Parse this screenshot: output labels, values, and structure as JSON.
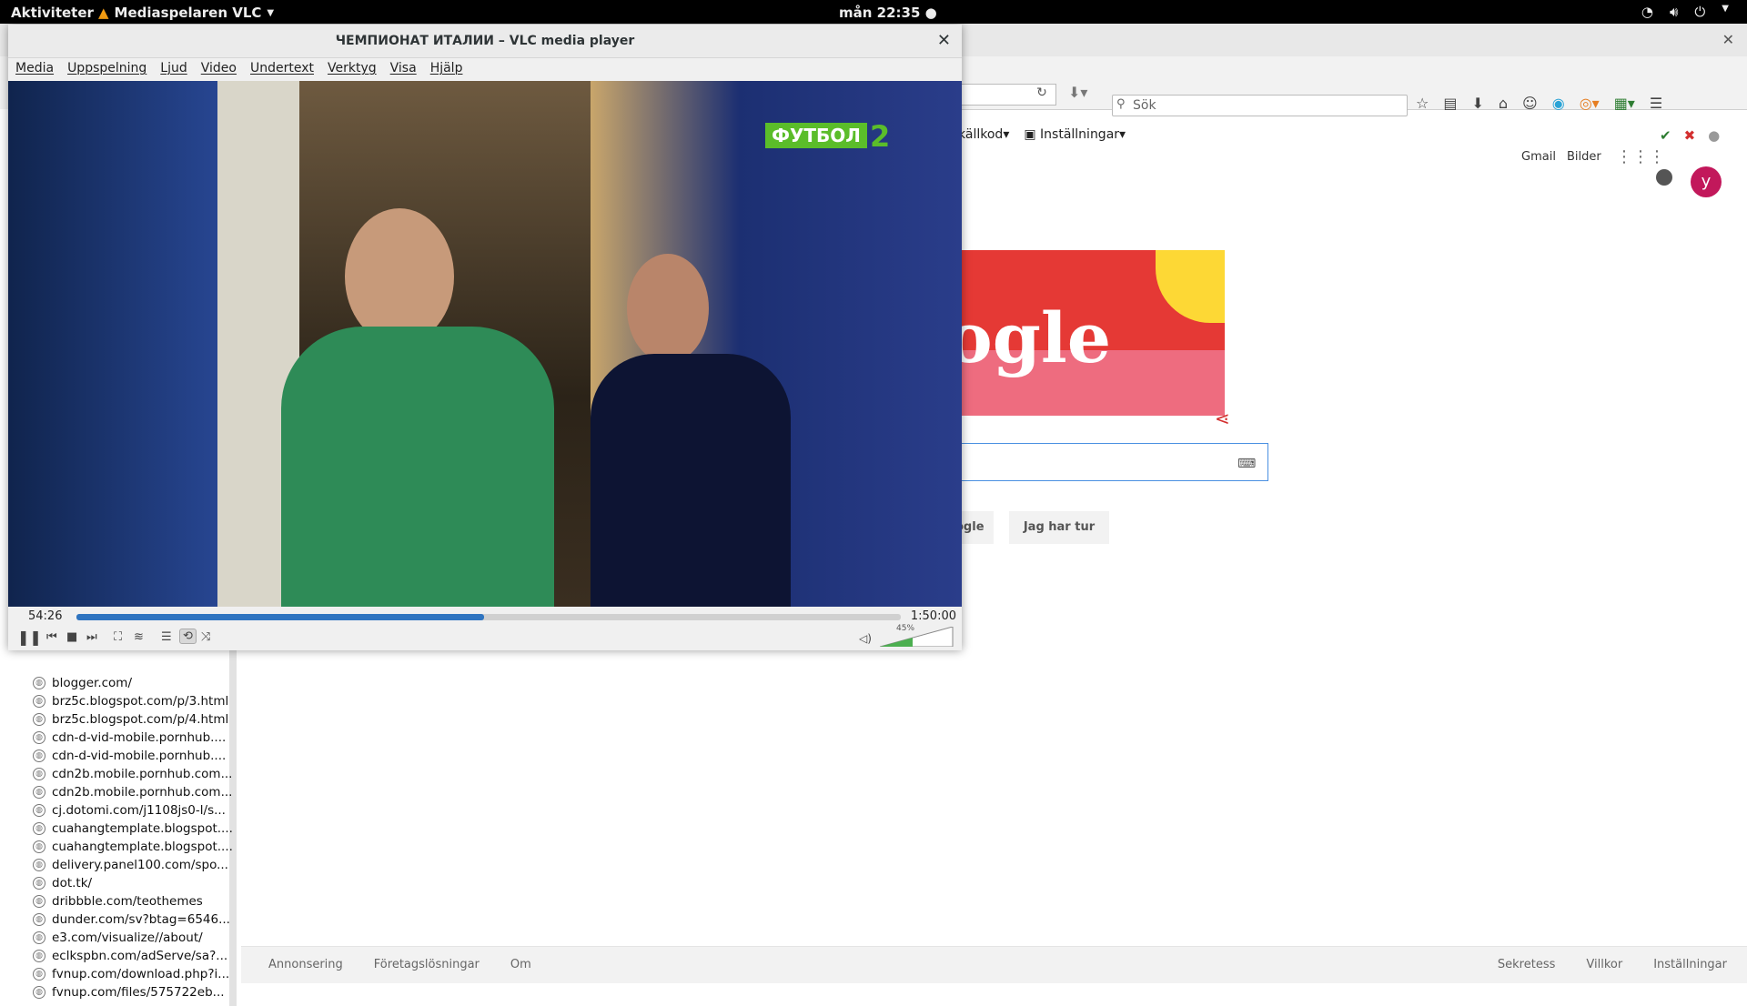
{
  "topbar": {
    "activities": "Aktiviteter",
    "app_name": "Mediaspelaren VLC",
    "clock": "mån 22:35"
  },
  "browser": {
    "search_placeholder": "Sök",
    "bookmarks": [
      "a källkod",
      "Inställningar"
    ],
    "history_items": [
      "blogger.com/",
      "brz5c.blogspot.com/p/3.html",
      "brz5c.blogspot.com/p/4.html",
      "cdn-d-vid-mobile.pornhub....",
      "cdn-d-vid-mobile.pornhub....",
      "cdn2b.mobile.pornhub.com...",
      "cdn2b.mobile.pornhub.com...",
      "cj.dotomi.com/j1108js0-l/s...",
      "cuahangtemplate.blogspot....",
      "cuahangtemplate.blogspot....",
      "delivery.panel100.com/spo...",
      "dot.tk/",
      "dribbble.com/teothemes",
      "dunder.com/sv?btag=6546...",
      "e3.com/visualize//about/",
      "eclkspbn.com/adServe/sa?...",
      "fvnup.com/download.php?i...",
      "fvnup.com/files/575722eb..."
    ]
  },
  "google": {
    "gmail": "Gmail",
    "images": "Bilder",
    "avatar_letter": "y",
    "doodle_text": "ogle",
    "btn_search_partial": "ogle",
    "btn_lucky": "Jag har tur",
    "footer_left": [
      "Annonsering",
      "Företagslösningar",
      "Om"
    ],
    "footer_right": [
      "Sekretess",
      "Villkor",
      "Inställningar"
    ]
  },
  "vlc": {
    "title": "ЧЕМПИОНАТ ИТАЛИИ – VLC media player",
    "menu": [
      "Media",
      "Uppspelning",
      "Ljud",
      "Video",
      "Undertext",
      "Verktyg",
      "Visa",
      "Hjälp"
    ],
    "channel_logo": "ФУТБОЛ",
    "channel_number": "2",
    "elapsed": "54:26",
    "total": "1:50:00",
    "progress_fraction": 0.495,
    "volume_label": "45%",
    "volume_fraction": 0.45
  }
}
